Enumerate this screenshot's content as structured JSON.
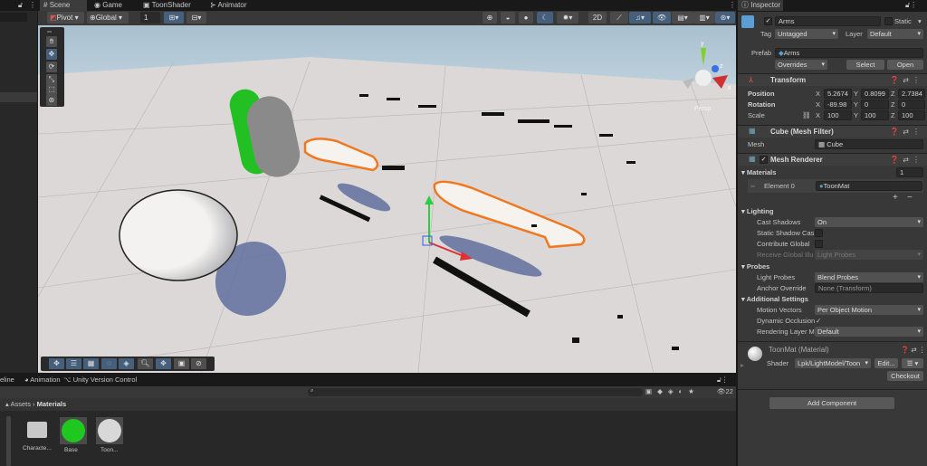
{
  "scene_tabs": [
    {
      "label": "Scene",
      "icon": "hash-icon"
    },
    {
      "label": "Game",
      "icon": "gamepad-icon"
    },
    {
      "label": "ToonShader",
      "icon": "shader-icon"
    },
    {
      "label": "Animator",
      "icon": "animator-icon"
    }
  ],
  "scene_toolbar": {
    "pivot": "Pivot",
    "global": "Global",
    "grid_snap": "1"
  },
  "scene_view": {
    "camera_mode": "Persp",
    "axis_labels": {
      "x": "x",
      "y": "y",
      "z": "z"
    }
  },
  "inspector": {
    "tab": "Inspector",
    "object_name": "Arms",
    "static_label": "Static",
    "tag_label": "Tag",
    "tag": "Untagged",
    "layer_label": "Layer",
    "layer": "Default",
    "prefab_label": "Prefab",
    "prefab": "Arms",
    "overrides": "Overrides",
    "select": "Select",
    "open": "Open",
    "transform": {
      "title": "Transform",
      "position_label": "Position",
      "rotation_label": "Rotation",
      "scale_label": "Scale",
      "position": {
        "x": "5.2674",
        "y": "0.8099",
        "z": "2.7384"
      },
      "rotation": {
        "x": "-89.98",
        "y": "0",
        "z": "0"
      },
      "scale": {
        "x": "100",
        "y": "100",
        "z": "100"
      },
      "axes": {
        "x": "X",
        "y": "Y",
        "z": "Z"
      }
    },
    "mesh_filter": {
      "title": "Cube (Mesh Filter)",
      "mesh_label": "Mesh",
      "mesh": "Cube"
    },
    "mesh_renderer": {
      "title": "Mesh Renderer",
      "materials_label": "Materials",
      "materials_count": "1",
      "element_label": "Element 0",
      "element": "ToonMat",
      "lighting": "Lighting",
      "cast_shadows_label": "Cast Shadows",
      "cast_shadows": "On",
      "static_shadow_label": "Static Shadow Cas",
      "contribute_gi_label": "Contribute Global",
      "receive_gi_label": "Receive Global Illu",
      "receive_gi": "Light Probes",
      "probes": "Probes",
      "light_probes_label": "Light Probes",
      "light_probes": "Blend Probes",
      "anchor_label": "Anchor Override",
      "anchor": "None (Transform)",
      "additional": "Additional Settings",
      "motion_vectors_label": "Motion Vectors",
      "motion_vectors": "Per Object Motion",
      "dynamic_occlusion_label": "Dynamic Occlusion",
      "rendering_layer_label": "Rendering Layer M",
      "rendering_layer": "Default"
    },
    "material": {
      "title": "ToonMat (Material)",
      "shader_label": "Shader",
      "shader": "Lpk/LightModel/Toon",
      "edit": "Edit...",
      "checkout": "Checkout"
    },
    "add_component": "Add Component"
  },
  "bottom": {
    "tabs": [
      "eline",
      "Animation",
      "Unity Version Control"
    ],
    "hidden_count": "22",
    "breadcrumb": [
      "Assets",
      "Materials"
    ],
    "assets": [
      {
        "name": "Characte...",
        "type": "folder"
      },
      {
        "name": "Base",
        "type": "material",
        "color": "#1ec81e"
      },
      {
        "name": "Toon...",
        "type": "material",
        "color": "#d8d8d8"
      }
    ]
  }
}
